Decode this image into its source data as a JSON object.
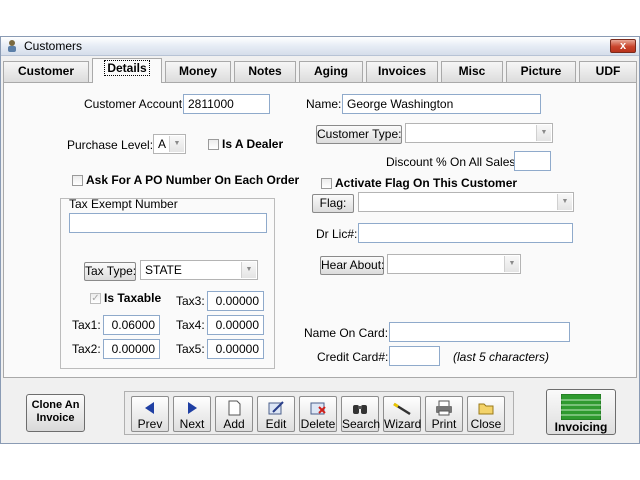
{
  "window": {
    "title": "Customers",
    "close_glyph": "x"
  },
  "tabs": [
    {
      "label": "Customer"
    },
    {
      "label": "Details"
    },
    {
      "label": "Money"
    },
    {
      "label": "Notes"
    },
    {
      "label": "Aging"
    },
    {
      "label": "Invoices"
    },
    {
      "label": "Misc"
    },
    {
      "label": "Picture"
    },
    {
      "label": "UDF"
    }
  ],
  "details": {
    "customer_account_label": "Customer Account:",
    "customer_account_value": "2811000",
    "purchase_level_label": "Purchase Level:",
    "purchase_level_value": "A",
    "is_dealer_label": "Is A Dealer",
    "ask_po_label": "Ask For A PO Number On Each Order",
    "tax_exempt_label": "Tax Exempt Number",
    "tax_exempt_value": "",
    "tax_type_button": "Tax Type:",
    "tax_type_value": "STATE",
    "is_taxable_label": "Is Taxable",
    "is_taxable_checked": true,
    "tax1_label": "Tax1:",
    "tax1_value": "0.06000",
    "tax2_label": "Tax2:",
    "tax2_value": "0.00000",
    "tax3_label": "Tax3:",
    "tax3_value": "0.00000",
    "tax4_label": "Tax4:",
    "tax4_value": "0.00000",
    "tax5_label": "Tax5:",
    "tax5_value": "0.00000",
    "name_label": "Name:",
    "name_value": "George Washington",
    "customer_type_button": "Customer Type:",
    "customer_type_value": "",
    "discount_label": "Discount % On All Sales:",
    "discount_value": "",
    "activate_flag_label": "Activate Flag On This Customer",
    "flag_button": "Flag:",
    "flag_value": "",
    "dr_lic_label": "Dr Lic#:",
    "dr_lic_value": "",
    "hear_about_button": "Hear About:",
    "hear_about_value": "",
    "name_on_card_label": "Name On Card:",
    "name_on_card_value": "",
    "credit_card_label": "Credit Card#:",
    "credit_card_value": "",
    "credit_card_hint": "(last 5 characters)"
  },
  "footer": {
    "clone_line1": "Clone An",
    "clone_line2": "Invoice",
    "toolbar": [
      {
        "label": "Prev",
        "icon": "arrow-left-icon"
      },
      {
        "label": "Next",
        "icon": "arrow-right-icon"
      },
      {
        "label": "Add",
        "icon": "document-icon"
      },
      {
        "label": "Edit",
        "icon": "edit-icon"
      },
      {
        "label": "Delete",
        "icon": "delete-icon"
      },
      {
        "label": "Search",
        "icon": "binoculars-icon"
      },
      {
        "label": "Wizard",
        "icon": "wand-icon"
      },
      {
        "label": "Print",
        "icon": "printer-icon"
      },
      {
        "label": "Close",
        "icon": "folder-icon"
      }
    ],
    "invoicing_label": "Invoicing"
  },
  "colors": {
    "accent_blue": "#1f3fa3",
    "invoice_green": "#2f9a2f",
    "close_red": "#c9442c",
    "field_border": "#8faacb"
  }
}
